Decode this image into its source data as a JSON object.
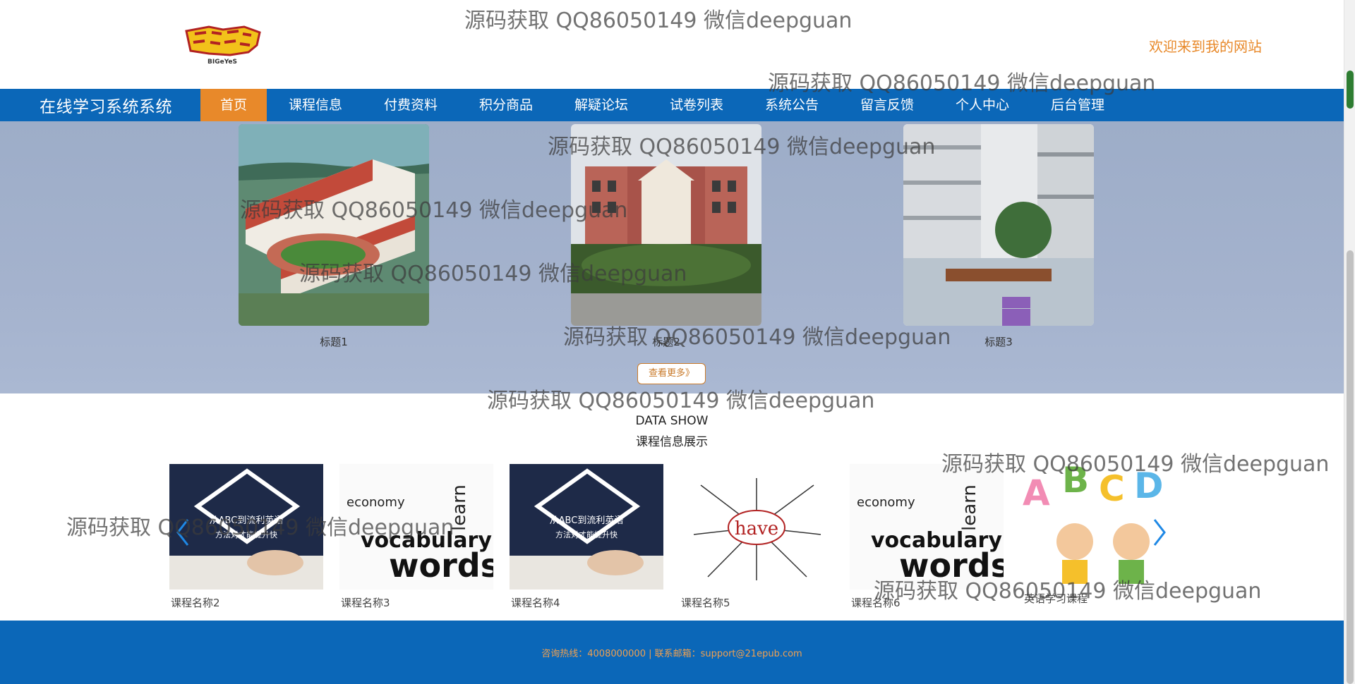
{
  "header": {
    "welcome": "欢迎来到我的网站",
    "logo_text": "BIGeYeS"
  },
  "nav": {
    "site_title": "在线学习系统系统",
    "items": [
      {
        "label": "首页",
        "active": true
      },
      {
        "label": "课程信息"
      },
      {
        "label": "付费资料"
      },
      {
        "label": "积分商品"
      },
      {
        "label": "解疑论坛"
      },
      {
        "label": "试卷列表"
      },
      {
        "label": "系统公告"
      },
      {
        "label": "留言反馈"
      },
      {
        "label": "个人中心"
      },
      {
        "label": "后台管理"
      }
    ]
  },
  "banner": {
    "photos": [
      {
        "caption": "标题1"
      },
      {
        "caption": "标题2"
      },
      {
        "caption": "标题3"
      }
    ],
    "more_button": "查看更多》"
  },
  "course_section": {
    "title_en": "DATA SHOW",
    "title_cn": "课程信息展示",
    "cards": [
      {
        "caption": "课程名称2",
        "img_text": [
          "从ABC到流利英语",
          "方法对才能提升快"
        ]
      },
      {
        "caption": "课程名称3",
        "img_text": [
          "vocabulary",
          "words",
          "learn",
          "economy"
        ]
      },
      {
        "caption": "课程名称4",
        "img_text": [
          "从ABC到流利英语",
          "方法对才能提升快"
        ]
      },
      {
        "caption": "课程名称5",
        "img_text": [
          "have"
        ]
      },
      {
        "caption": "课程名称6",
        "img_text": [
          "vocabulary",
          "words",
          "learn",
          "economy"
        ]
      },
      {
        "caption": "英语学习课程",
        "img_text": [
          "A",
          "B",
          "C",
          "D"
        ]
      }
    ]
  },
  "footer": {
    "text": "咨询热线：4008000000 | 联系邮箱：support@21epub.com"
  },
  "watermark": "源码获取 QQ86050149 微信deepguan",
  "colors": {
    "nav_blue": "#0b67b8",
    "accent_orange": "#e8892a"
  }
}
